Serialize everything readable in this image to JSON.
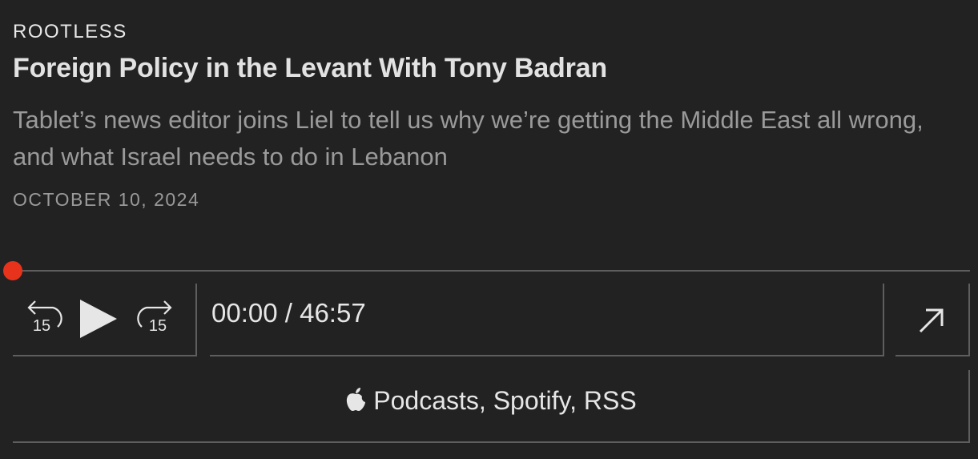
{
  "episode": {
    "kicker": "ROOTLESS",
    "title": "Foreign Policy in the Levant With Tony Badran",
    "subtitle": "Tablet’s news editor joins Liel to tell us why we’re getting the Middle East all wrong, and what Israel needs to do in Lebanon",
    "date": "OCTOBER 10, 2024"
  },
  "player": {
    "progress_fraction": 0,
    "skip_back_label": "15",
    "skip_forward_label": "15",
    "time_display": "00:00 / 46:57",
    "accent_color": "#e8331c",
    "icons": [
      "skip-back-15-icon",
      "play-icon",
      "skip-forward-15-icon",
      "external-link-arrow-icon",
      "apple-icon"
    ]
  },
  "subscribe": {
    "label": "Podcasts, Spotify, RSS"
  }
}
